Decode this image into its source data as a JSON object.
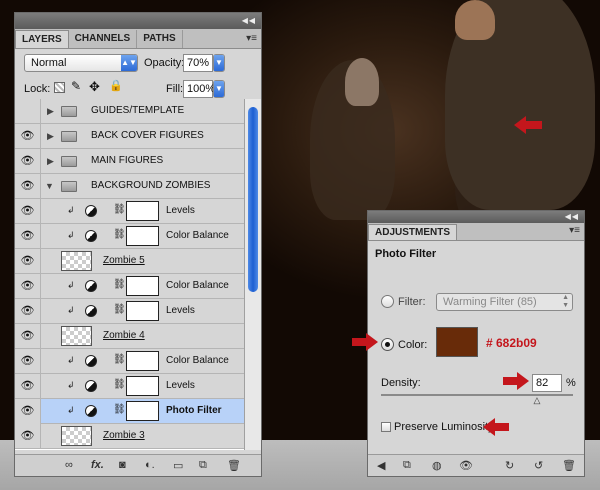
{
  "layers_panel": {
    "tabs": [
      {
        "label": "LAYERS"
      },
      {
        "label": "CHANNELS"
      },
      {
        "label": "PATHS"
      }
    ],
    "blend_mode": "Normal",
    "opacity_label": "Opacity:",
    "opacity_value": "70%",
    "lock_label": "Lock:",
    "fill_label": "Fill:",
    "fill_value": "100%",
    "layers": [
      {
        "name": "GUIDES/TEMPLATE",
        "type": "group",
        "visible": false
      },
      {
        "name": "BACK COVER FIGURES",
        "type": "group",
        "visible": true
      },
      {
        "name": "MAIN FIGURES",
        "type": "group",
        "visible": true
      },
      {
        "name": "BACKGROUND ZOMBIES",
        "type": "group",
        "visible": true,
        "expanded": true
      },
      {
        "name": "Levels",
        "type": "adjustment",
        "visible": true
      },
      {
        "name": "Color Balance",
        "type": "adjustment",
        "visible": true
      },
      {
        "name": "Zombie 5",
        "type": "pixel",
        "visible": true
      },
      {
        "name": "Color Balance",
        "type": "adjustment",
        "visible": true
      },
      {
        "name": "Levels",
        "type": "adjustment",
        "visible": true
      },
      {
        "name": "Zombie 4",
        "type": "pixel",
        "visible": true
      },
      {
        "name": "Color Balance",
        "type": "adjustment",
        "visible": true
      },
      {
        "name": "Levels",
        "type": "adjustment",
        "visible": true
      },
      {
        "name": "Photo Filter",
        "type": "adjustment",
        "visible": true,
        "selected": true
      },
      {
        "name": "Zombie 3",
        "type": "pixel",
        "visible": true
      }
    ],
    "footer_icons": [
      "link-icon",
      "fx-icon",
      "mask-icon",
      "adjustment-icon",
      "folder-icon",
      "new-layer-icon",
      "trash-icon"
    ]
  },
  "adjustments_panel": {
    "tab": "ADJUSTMENTS",
    "title": "Photo Filter",
    "filter_label": "Filter:",
    "filter_value": "Warming Filter (85)",
    "color_label": "Color:",
    "color_swatch": "#682b09",
    "color_annotation": "# 682b09",
    "density_label": "Density:",
    "density_value": "82",
    "density_unit": "%",
    "density_fraction": 0.82,
    "preserve_label": "Preserve Luminosity",
    "preserve_checked": false,
    "footer_icons": [
      "back-icon",
      "clip-icon",
      "visibility-icon",
      "eye-icon",
      "previous-state-icon",
      "reset-icon",
      "trash-icon"
    ]
  },
  "colors": {
    "selected_row": "#b8d2f8",
    "annotation_red": "#c4161c",
    "accent_blue": "#2d6ad6"
  }
}
